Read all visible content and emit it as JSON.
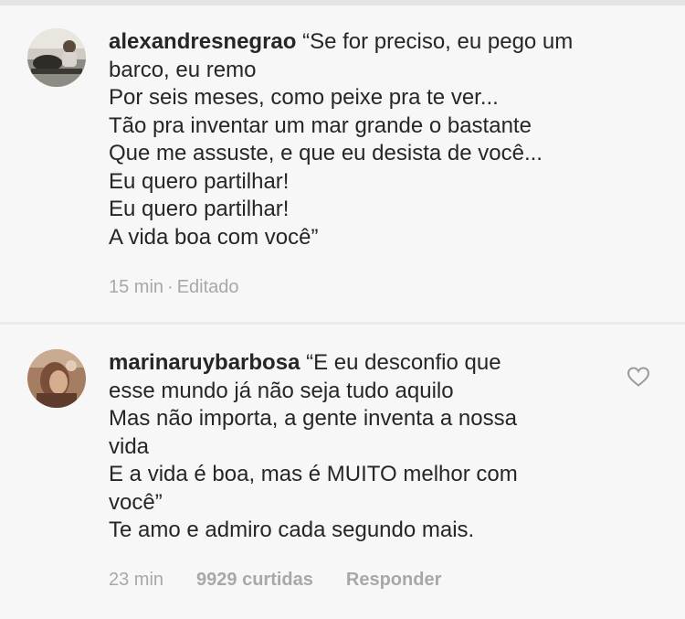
{
  "comments": [
    {
      "username": "alexandresnegrao",
      "lines": [
        "“Se for preciso, eu pego um",
        "barco, eu remo",
        "Por seis meses, como peixe pra te ver...",
        "Tão pra inventar um mar grande o bastante",
        "Que me assuste, e que eu desista de você...",
        "Eu quero partilhar!",
        "Eu quero partilhar!",
        "A vida boa com você”"
      ],
      "time": "15 min",
      "separator": "·",
      "edited": "Editado"
    },
    {
      "username": "marinaruybarbosa",
      "lines": [
        "“E eu desconfio que",
        "esse mundo já não seja tudo aquilo",
        "Mas não importa, a gente inventa a nossa",
        "vida",
        "E a vida é boa, mas é MUITO melhor com",
        "você”",
        "Te amo e admiro cada segundo mais."
      ],
      "time": "23 min",
      "likes": "9929 curtidas",
      "reply": "Responder"
    }
  ],
  "icons": {
    "like": "heart-outline-icon"
  },
  "colors": {
    "text": "#262626",
    "meta": "#a8a8a8",
    "background": "#f7f7f7"
  }
}
